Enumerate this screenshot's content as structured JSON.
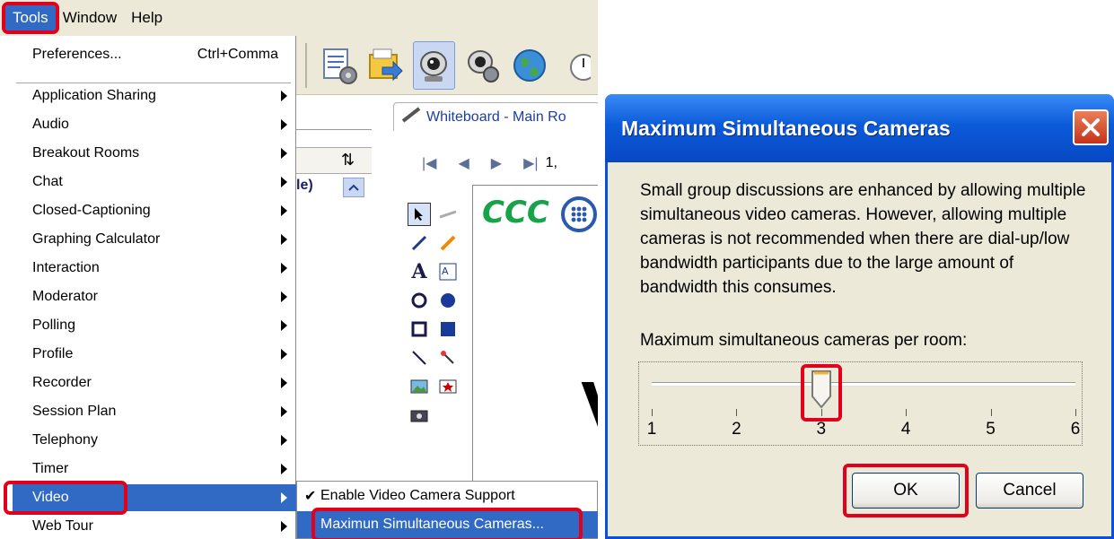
{
  "menubar": {
    "items": [
      {
        "label": "Tools",
        "active": true
      },
      {
        "label": "Window"
      },
      {
        "label": "Help"
      }
    ]
  },
  "tools_menu": {
    "preferences": {
      "label": "Preferences...",
      "shortcut": "Ctrl+Comma"
    },
    "items": [
      {
        "label": "Application Sharing"
      },
      {
        "label": "Audio"
      },
      {
        "label": "Breakout Rooms"
      },
      {
        "label": "Chat"
      },
      {
        "label": "Closed-Captioning"
      },
      {
        "label": "Graphing Calculator"
      },
      {
        "label": "Interaction"
      },
      {
        "label": "Moderator"
      },
      {
        "label": "Polling"
      },
      {
        "label": "Profile"
      },
      {
        "label": "Recorder"
      },
      {
        "label": "Session Plan"
      },
      {
        "label": "Telephony"
      },
      {
        "label": "Timer"
      },
      {
        "label": "Video",
        "highlighted": true
      },
      {
        "label": "Web Tour"
      }
    ]
  },
  "video_submenu": {
    "items": [
      {
        "label": "Enable Video Camera Support",
        "checked": true
      },
      {
        "label": "Maximun Simultaneous Cameras...",
        "highlighted": true
      }
    ]
  },
  "participants": {
    "role_fragment": "le)"
  },
  "whiteboard": {
    "tab_title": "Whiteboard - Main Ro",
    "page_fragment": "1,",
    "logo_text": "CCC",
    "big_letter": "V"
  },
  "toolbar": {
    "icons": [
      "preferences-icon",
      "load-icon",
      "camera-icon",
      "camera-settings-icon",
      "globe-icon",
      "timer-icon"
    ]
  },
  "dialog": {
    "title": "Maximum Simultaneous Cameras",
    "description": "Small group discussions are enhanced by allowing multiple simultaneous video cameras.  However, allowing multiple cameras is not recommended when there are dial-up/low bandwidth participants due to the large amount of bandwidth this consumes.",
    "slider_label": "Maximum simultaneous cameras per room:",
    "slider": {
      "min": 1,
      "max": 6,
      "value": 3,
      "ticks": [
        "1",
        "2",
        "3",
        "4",
        "5",
        "6"
      ]
    },
    "ok_label": "OK",
    "cancel_label": "Cancel"
  },
  "colors": {
    "highlight": "#316ac5",
    "annotation_red": "#e3001b",
    "titlebar": "#0b5bd9",
    "dialog_bg": "#ece9d8"
  }
}
